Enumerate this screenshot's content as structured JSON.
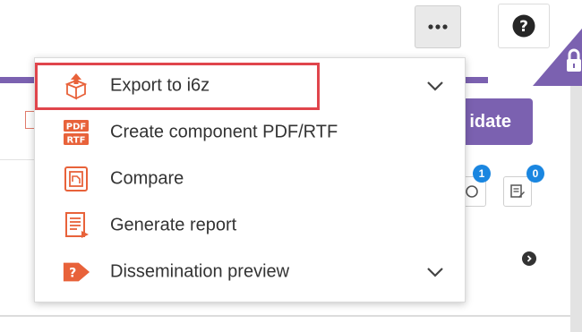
{
  "toolbar": {
    "more_icon": "ellipsis-icon",
    "help_icon": "question-circle-icon",
    "lock_icon": "lock-icon"
  },
  "validate": {
    "label": "idate"
  },
  "badges": {
    "first": "1",
    "second": "0"
  },
  "menu": {
    "items": [
      {
        "label": "Export to i6z",
        "icon": "export-box-icon",
        "has_chevron": true,
        "highlighted": true
      },
      {
        "label": "Create component PDF/RTF",
        "icon": "pdf-rtf-icon",
        "has_chevron": false
      },
      {
        "label": "Compare",
        "icon": "compare-icon",
        "has_chevron": false
      },
      {
        "label": "Generate report",
        "icon": "report-icon",
        "has_chevron": false
      },
      {
        "label": "Dissemination preview",
        "icon": "preview-arrow-icon",
        "has_chevron": true
      }
    ],
    "pdf_icon_text": {
      "top": "PDF",
      "bottom": "RTF"
    },
    "preview_icon_text": "?"
  },
  "colors": {
    "accent_purple": "#7b61b0",
    "icon_orange": "#e8623a",
    "highlight_red": "#e0454c",
    "badge_blue": "#1a86e0"
  }
}
